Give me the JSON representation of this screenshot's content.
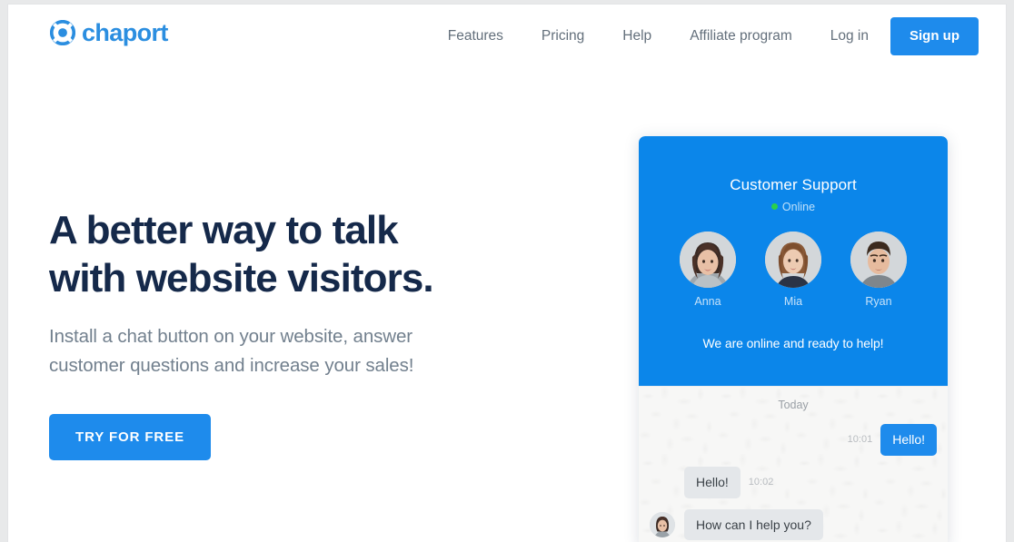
{
  "brand": {
    "name": "chaport",
    "logo_icon": "lifebuoy-icon",
    "accent_color": "#1e8bec",
    "header_color": "#0b86ea",
    "title_color": "#15294a"
  },
  "nav": {
    "items": [
      {
        "label": "Features"
      },
      {
        "label": "Pricing"
      },
      {
        "label": "Help"
      },
      {
        "label": "Affiliate program"
      },
      {
        "label": "Log in"
      }
    ],
    "signup_label": "Sign up"
  },
  "hero": {
    "title_line1": "A better way to talk",
    "title_line2": "with website visitors.",
    "subtitle_line1": "Install a chat button on your website, answer",
    "subtitle_line2": "customer questions and increase your sales!",
    "cta_label": "TRY FOR FREE"
  },
  "widget": {
    "title": "Customer Support",
    "status": "Online",
    "status_color": "#2ad04b",
    "welcome": "We are online and ready to help!",
    "agents": [
      {
        "name": "Anna"
      },
      {
        "name": "Mia"
      },
      {
        "name": "Ryan"
      }
    ],
    "day_divider": "Today",
    "messages": [
      {
        "direction": "out",
        "text": "Hello!",
        "time": "10:01"
      },
      {
        "direction": "in",
        "text": "Hello!",
        "time": "10:02"
      },
      {
        "direction": "in",
        "text": "How can I help you?",
        "time": ""
      }
    ]
  }
}
